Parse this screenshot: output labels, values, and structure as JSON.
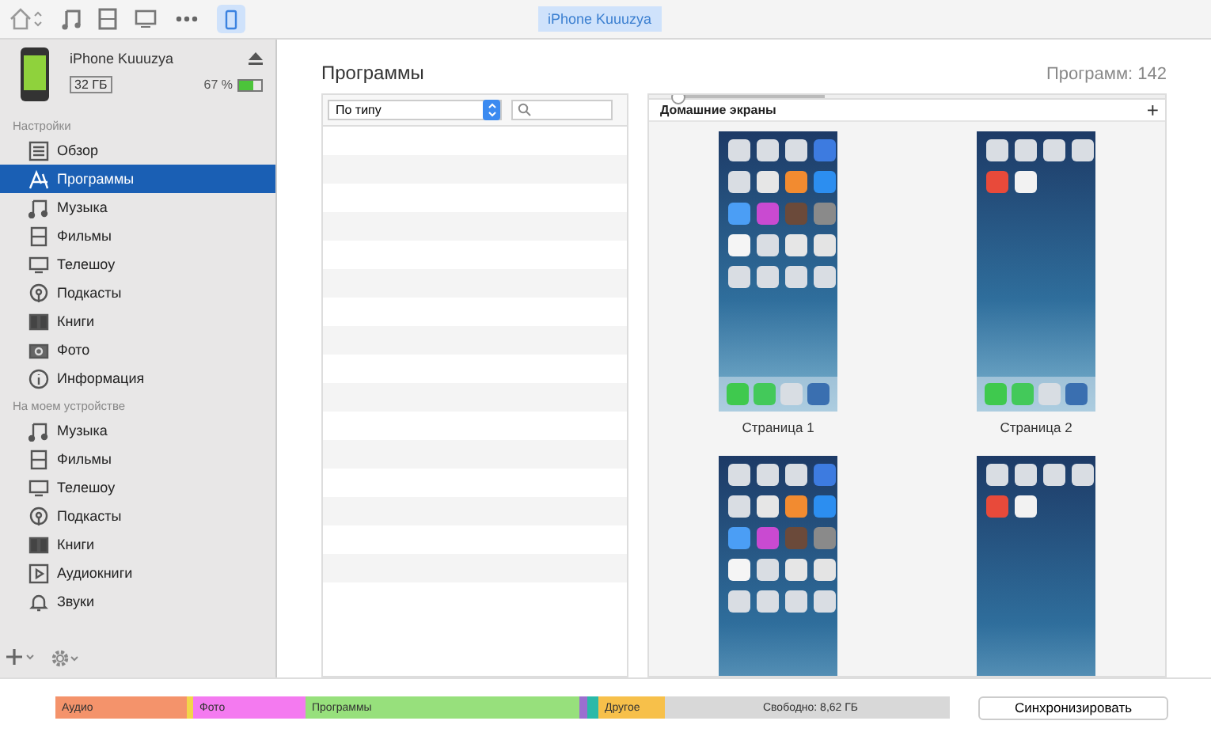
{
  "toolbar": {
    "device_button": {
      "selected": true
    },
    "device_name": "iPhone Kuuuzya"
  },
  "device": {
    "name": "iPhone Kuuuzya",
    "capacity": "32 ГБ",
    "battery": "67 %",
    "battery_level": {
      "level": 0.67
    }
  },
  "sidebar": {
    "sections": [
      {
        "title": "Настройки",
        "items": [
          {
            "label": "Обзор",
            "kind": "summary",
            "selected": false
          },
          {
            "label": "Программы",
            "kind": "apps",
            "selected": true
          },
          {
            "label": "Музыка",
            "kind": "music",
            "selected": false
          },
          {
            "label": "Фильмы",
            "kind": "film",
            "selected": false
          },
          {
            "label": "Телешоу",
            "kind": "tv",
            "selected": false
          },
          {
            "label": "Подкасты",
            "kind": "podcast",
            "selected": false
          },
          {
            "label": "Книги",
            "kind": "book",
            "selected": false
          },
          {
            "label": "Фото",
            "kind": "camera",
            "selected": false
          },
          {
            "label": "Информация",
            "kind": "info",
            "selected": false
          }
        ]
      },
      {
        "title": "На моем устройстве",
        "items": [
          {
            "label": "Музыка",
            "kind": "music",
            "selected": false
          },
          {
            "label": "Фильмы",
            "kind": "film",
            "selected": false
          },
          {
            "label": "Телешоу",
            "kind": "tv",
            "selected": false
          },
          {
            "label": "Подкасты",
            "kind": "podcast",
            "selected": false
          },
          {
            "label": "Книги",
            "kind": "book",
            "selected": false
          },
          {
            "label": "Аудиокниги",
            "kind": "audiobook",
            "selected": false
          },
          {
            "label": "Звуки",
            "kind": "bell",
            "selected": false
          }
        ]
      }
    ]
  },
  "main": {
    "title": "Программы",
    "count": "Программ: 142",
    "sort": "По типу",
    "zoom_slider": {
      "level": 0.02
    },
    "home_screens": {
      "title": "Домашние экраны",
      "add": "+",
      "pages": [
        {
          "label": "Страница 1",
          "kind": "full"
        },
        {
          "label": "Страница 2",
          "kind": "sparse"
        },
        {
          "kind": "full"
        },
        {
          "kind": "sparse"
        }
      ]
    }
  },
  "storage": {
    "segments": [
      {
        "label": "Аудио",
        "color": "#f4936b"
      },
      {
        "color": "#f2d54a"
      },
      {
        "label": "Фото",
        "color": "#f47af0"
      },
      {
        "label": "Программы",
        "color": "#97e07c"
      },
      {
        "color": "#9b6fd0"
      },
      {
        "color": "#2bb9a8"
      },
      {
        "label": "Другое",
        "color": "#f7c04a"
      },
      {
        "label": "Свободно: 8,62 ГБ",
        "color": "#d8d8d8"
      }
    ],
    "sync_button": "Синхронизировать"
  }
}
